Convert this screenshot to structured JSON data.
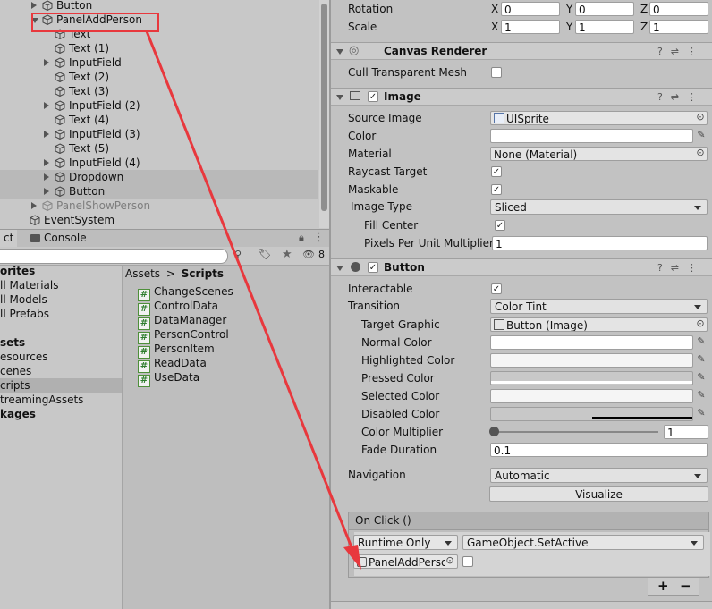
{
  "hierarchy": {
    "items": [
      {
        "label": "Button",
        "depth": 1,
        "toggle": "closed",
        "dim": false,
        "selected": false
      },
      {
        "label": "PanelAddPerson",
        "depth": 1,
        "toggle": "open",
        "dim": false,
        "selected": false
      },
      {
        "label": "Text",
        "depth": 2,
        "toggle": "none",
        "dim": false,
        "selected": false
      },
      {
        "label": "Text (1)",
        "depth": 2,
        "toggle": "none",
        "dim": false,
        "selected": false
      },
      {
        "label": "InputField",
        "depth": 2,
        "toggle": "closed",
        "dim": false,
        "selected": false
      },
      {
        "label": "Text (2)",
        "depth": 2,
        "toggle": "none",
        "dim": false,
        "selected": false
      },
      {
        "label": "Text (3)",
        "depth": 2,
        "toggle": "none",
        "dim": false,
        "selected": false
      },
      {
        "label": "InputField (2)",
        "depth": 2,
        "toggle": "closed",
        "dim": false,
        "selected": false
      },
      {
        "label": "Text (4)",
        "depth": 2,
        "toggle": "none",
        "dim": false,
        "selected": false
      },
      {
        "label": "InputField (3)",
        "depth": 2,
        "toggle": "closed",
        "dim": false,
        "selected": false
      },
      {
        "label": "Text (5)",
        "depth": 2,
        "toggle": "none",
        "dim": false,
        "selected": false
      },
      {
        "label": "InputField (4)",
        "depth": 2,
        "toggle": "closed",
        "dim": false,
        "selected": false
      },
      {
        "label": "Dropdown",
        "depth": 2,
        "toggle": "closed",
        "dim": false,
        "selected": true
      },
      {
        "label": "Button",
        "depth": 2,
        "toggle": "closed",
        "dim": false,
        "selected": true
      },
      {
        "label": "PanelShowPerson",
        "depth": 1,
        "toggle": "closed",
        "dim": true,
        "selected": false
      },
      {
        "label": "EventSystem",
        "depth": 0,
        "toggle": "none",
        "dim": false,
        "selected": false
      }
    ]
  },
  "project": {
    "tabs": [
      "ct",
      "Console"
    ],
    "search_count": "8",
    "left_items": [
      {
        "label": "orites",
        "bold": true,
        "selected": false
      },
      {
        "label": "ll Materials",
        "bold": false,
        "selected": false
      },
      {
        "label": "ll Models",
        "bold": false,
        "selected": false
      },
      {
        "label": "ll Prefabs",
        "bold": false,
        "selected": false
      },
      {
        "label": "",
        "bold": false,
        "selected": false
      },
      {
        "label": "sets",
        "bold": true,
        "selected": false
      },
      {
        "label": "esources",
        "bold": false,
        "selected": false
      },
      {
        "label": "cenes",
        "bold": false,
        "selected": false
      },
      {
        "label": "cripts",
        "bold": false,
        "selected": true
      },
      {
        "label": "treamingAssets",
        "bold": false,
        "selected": false
      },
      {
        "label": "kages",
        "bold": true,
        "selected": false
      }
    ],
    "breadcrumb": {
      "root": "Assets",
      "sep": ">",
      "current": "Scripts"
    },
    "scripts": [
      "ChangeScenes",
      "ControlData",
      "DataManager",
      "PersonControl",
      "PersonItem",
      "ReadData",
      "UseData"
    ]
  },
  "inspector": {
    "rotation": {
      "label": "Rotation",
      "x": "0",
      "y": "0",
      "z": "0"
    },
    "scale": {
      "label": "Scale",
      "x": "1",
      "y": "1",
      "z": "1"
    },
    "canvas_renderer": {
      "title": "Canvas Renderer",
      "cull_label": "Cull Transparent Mesh"
    },
    "image": {
      "title": "Image",
      "source_image_label": "Source Image",
      "source_image_value": "UISprite",
      "color_label": "Color",
      "material_label": "Material",
      "material_value": "None (Material)",
      "raycast_label": "Raycast Target",
      "maskable_label": "Maskable",
      "image_type_label": "Image Type",
      "image_type_value": "Sliced",
      "fill_center_label": "Fill Center",
      "ppu_label": "Pixels Per Unit Multiplier",
      "ppu_value": "1"
    },
    "button": {
      "title": "Button",
      "interactable_label": "Interactable",
      "transition_label": "Transition",
      "transition_value": "Color Tint",
      "target_graphic_label": "Target Graphic",
      "target_graphic_value": "Button (Image)",
      "normal_label": "Normal Color",
      "highlighted_label": "Highlighted Color",
      "pressed_label": "Pressed Color",
      "selected_label": "Selected Color",
      "disabled_label": "Disabled Color",
      "multiplier_label": "Color Multiplier",
      "multiplier_value": "1",
      "multiplier_fraction": 0.0,
      "fade_label": "Fade Duration",
      "fade_value": "0.1",
      "navigation_label": "Navigation",
      "navigation_value": "Automatic",
      "visualize_label": "Visualize"
    },
    "onclick": {
      "title": "On Click ()",
      "runtime_value": "Runtime Only",
      "function_value": "GameObject.SetActive",
      "object_value": "PanelAddPerson",
      "plus": "+",
      "minus": "−"
    }
  },
  "colors": {
    "annotation": "#e8383d",
    "panel": "#c2c2c2"
  }
}
